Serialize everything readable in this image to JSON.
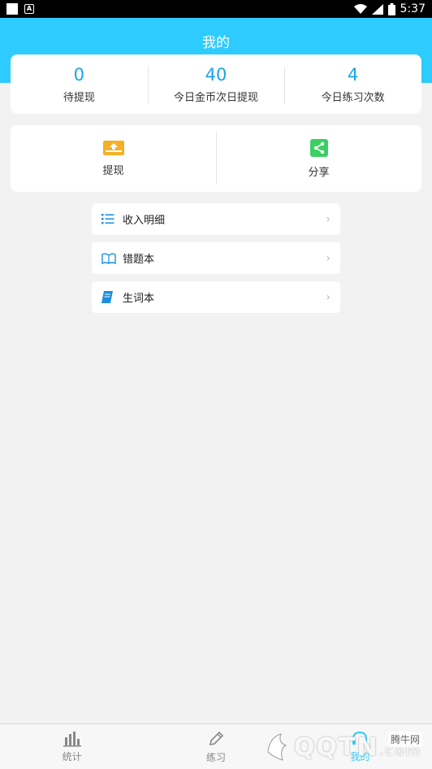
{
  "status_bar": {
    "time": "5:37"
  },
  "header": {
    "title": "我的"
  },
  "stats": [
    {
      "value": "0",
      "label": "待提现"
    },
    {
      "value": "40",
      "label": "今日金币次日提现"
    },
    {
      "value": "4",
      "label": "今日练习次数"
    }
  ],
  "actions": [
    {
      "label": "提现",
      "icon": "withdraw-icon",
      "color": "#f5b027"
    },
    {
      "label": "分享",
      "icon": "share-icon",
      "color": "#3ccf63"
    }
  ],
  "menu": [
    {
      "label": "收入明细",
      "icon": "list-icon"
    },
    {
      "label": "错题本",
      "icon": "open-book-icon"
    },
    {
      "label": "生词本",
      "icon": "notebook-icon"
    }
  ],
  "tabs": [
    {
      "label": "统计",
      "icon": "bar-chart-icon"
    },
    {
      "label": "练习",
      "icon": "pencil-icon"
    },
    {
      "label": "我的",
      "icon": "headset-icon",
      "active": true
    }
  ],
  "watermark": {
    "text": "QQTN",
    "suffix": ".com",
    "cn": "腾牛网"
  },
  "colors": {
    "primary": "#2ecbff",
    "stat_value": "#1aa3e8",
    "background": "#f2f2f2"
  }
}
